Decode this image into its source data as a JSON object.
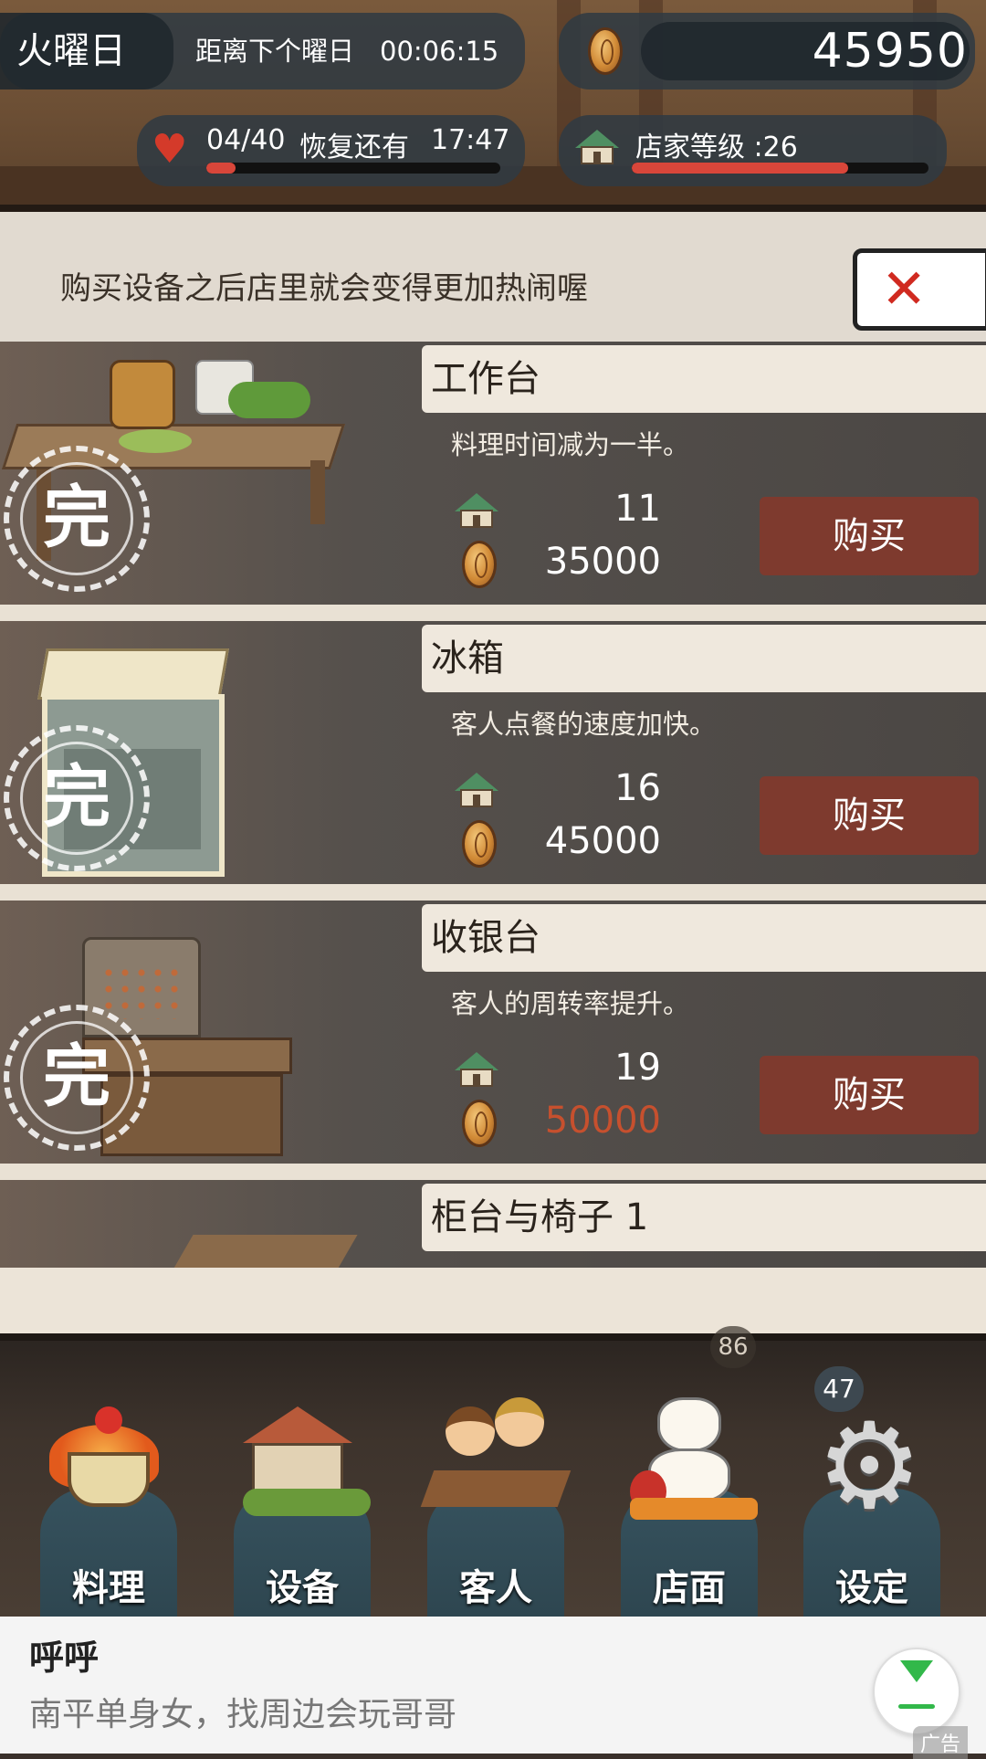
{
  "hud": {
    "weekday": "火曜日",
    "next_day_label": "距离下个曜日",
    "next_day_timer": "00:06:15",
    "coins": "45950",
    "stamina": "04/40",
    "stamina_recover_label": "恢复还有",
    "stamina_timer": "17:47",
    "stamina_fraction": 0.1,
    "shop_level": "店家等级 :26",
    "shop_level_fraction": 0.73
  },
  "banner": {
    "text": "购买设备之后店里就会变得更加热闹喔"
  },
  "items": [
    {
      "title": "工作台",
      "desc": "料理时间减为一半。",
      "level": "11",
      "price": "35000",
      "buy": "购买",
      "done": "完",
      "affordable": true
    },
    {
      "title": "冰箱",
      "desc": "客人点餐的速度加快。",
      "level": "16",
      "price": "45000",
      "buy": "购买",
      "done": "完",
      "affordable": true
    },
    {
      "title": "收银台",
      "desc": "客人的周转率提升。",
      "level": "19",
      "price": "50000",
      "buy": "购买",
      "done": "完",
      "affordable": false
    },
    {
      "title": "柜台与椅子 1"
    }
  ],
  "nav": {
    "tabs": [
      {
        "label": "料理",
        "icon": "cooking-pot-icon"
      },
      {
        "label": "设备",
        "icon": "shop-building-icon"
      },
      {
        "label": "客人",
        "icon": "customers-icon"
      },
      {
        "label": "店面",
        "icon": "lucky-cat-icon"
      },
      {
        "label": "设定",
        "icon": "gear-icon"
      }
    ],
    "badge_a": "86",
    "badge_b": "47"
  },
  "ad": {
    "title": "呼呼",
    "text": "南平单身女，找周边会玩哥哥",
    "label": "广告"
  },
  "colors": {
    "buy_button": "#7e3a2e",
    "price_short": "#c6502e",
    "bar_fill": "#d8463a"
  }
}
